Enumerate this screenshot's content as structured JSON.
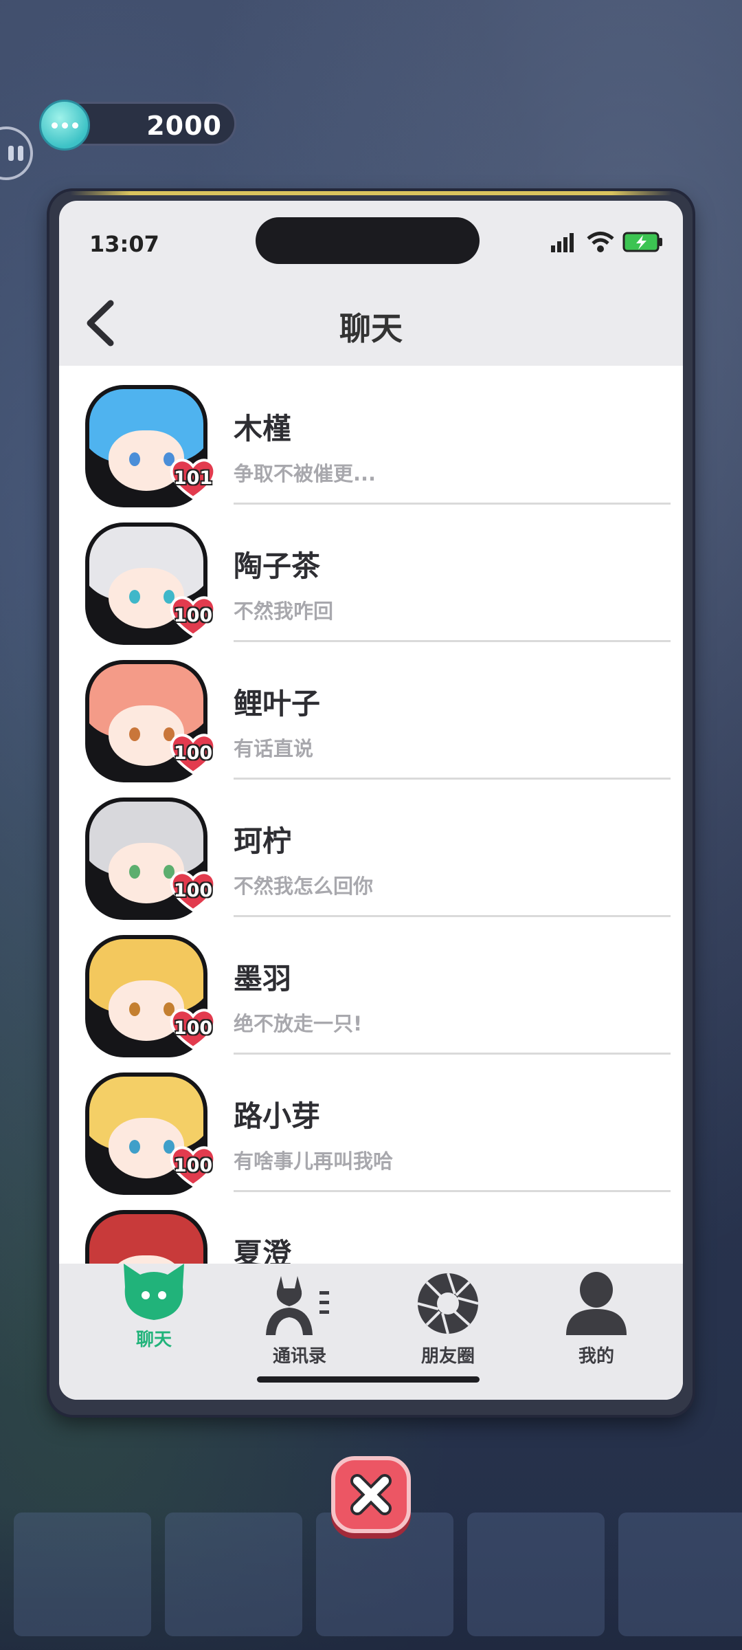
{
  "hud": {
    "coin_value": "2000",
    "coin_icon": "chat-bubble-coin-icon",
    "side_icon": "pause-icon"
  },
  "status_bar": {
    "time": "13:07"
  },
  "header": {
    "title": "聊天",
    "back_icon": "chevron-left-icon"
  },
  "chats": [
    {
      "name": "木槿",
      "preview": "争取不被催更...",
      "affection": "101",
      "hair": "#4fb3ef",
      "eye": "#4a8ed8"
    },
    {
      "name": "陶子茶",
      "preview": "不然我咋回",
      "affection": "100",
      "hair": "#e6e6ea",
      "eye": "#3fb7c9"
    },
    {
      "name": "鲤叶子",
      "preview": "有话直说",
      "affection": "100",
      "hair": "#f49b88",
      "eye": "#c9763a"
    },
    {
      "name": "珂柠",
      "preview": "不然我怎么回你",
      "affection": "100",
      "hair": "#d8d8dc",
      "eye": "#5cae6e"
    },
    {
      "name": "墨羽",
      "preview": "绝不放走一只!",
      "affection": "100",
      "hair": "#f3c85d",
      "eye": "#c47f30"
    },
    {
      "name": "路小芽",
      "preview": "有啥事儿再叫我哈",
      "affection": "100",
      "hair": "#f4cf66",
      "eye": "#3f9fc9"
    },
    {
      "name": "夏澄",
      "preview": "",
      "affection": "",
      "hair": "#c83a3a",
      "eye": "#8a2e2e"
    }
  ],
  "tab_bar": {
    "tabs": [
      {
        "label": "聊天",
        "icon": "chat-cat-icon",
        "active": true
      },
      {
        "label": "通讯录",
        "icon": "contacts-icon",
        "active": false
      },
      {
        "label": "朋友圈",
        "icon": "aperture-icon",
        "active": false
      },
      {
        "label": "我的",
        "icon": "profile-icon",
        "active": false
      }
    ]
  },
  "close_icon": "close-icon",
  "colors": {
    "accent_green": "#21b37a",
    "heart_red": "#e23b4e",
    "close_red": "#ec5664"
  }
}
